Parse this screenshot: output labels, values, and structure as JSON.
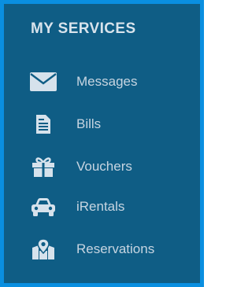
{
  "panel": {
    "title": "MY SERVICES",
    "background_color": "#0f5d85",
    "border_color": "#0a8fe0",
    "icon_color": "#d6e2ec",
    "text_color": "#c7d5e1"
  },
  "menu": {
    "items": [
      {
        "label": "Messages",
        "icon": "envelope-icon"
      },
      {
        "label": "Bills",
        "icon": "document-icon"
      },
      {
        "label": "Vouchers",
        "icon": "gift-icon"
      },
      {
        "label": "iRentals",
        "icon": "car-icon"
      },
      {
        "label": "Reservations",
        "icon": "map-pin-icon"
      }
    ]
  }
}
